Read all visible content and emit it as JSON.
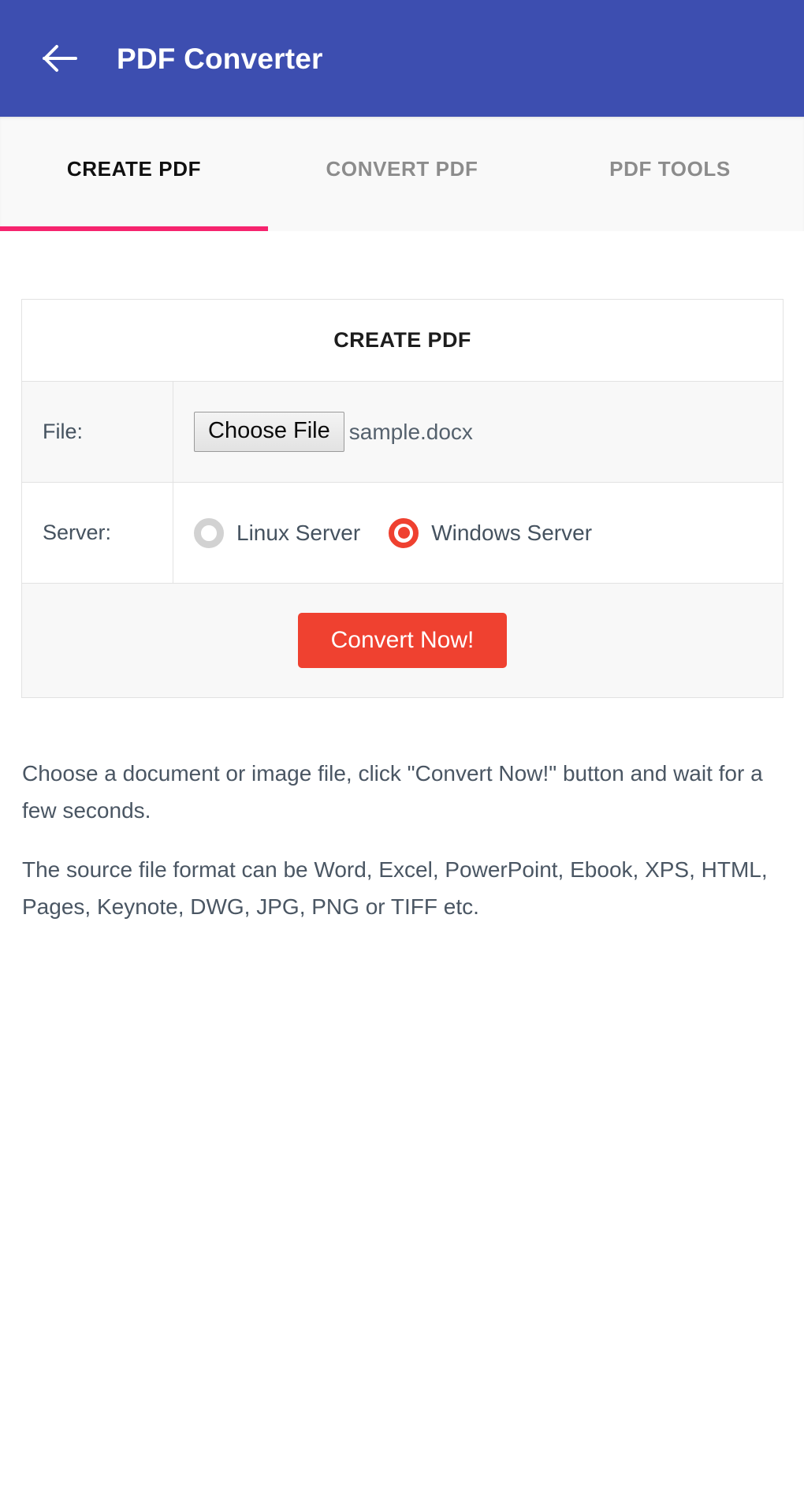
{
  "appbar": {
    "back_icon": "arrow-left-icon",
    "title": "PDF Converter",
    "background_color": "#3d4eb0"
  },
  "tabs": {
    "indicator_color": "#f6246e",
    "items": [
      {
        "label": "CREATE PDF",
        "active": true
      },
      {
        "label": "CONVERT PDF",
        "active": false
      },
      {
        "label": "PDF TOOLS",
        "active": false
      }
    ]
  },
  "card": {
    "header": "CREATE PDF",
    "file_row": {
      "label": "File:",
      "choose_button": "Choose File",
      "file_name": "sample.docx"
    },
    "server_row": {
      "label": "Server:",
      "options": [
        {
          "label": "Linux Server",
          "selected": false
        },
        {
          "label": "Windows Server",
          "selected": true
        }
      ],
      "selected_color": "#ef4130"
    },
    "submit": {
      "label": "Convert Now!",
      "color": "#ef4130"
    }
  },
  "help": {
    "paragraph1": "Choose a document or image file, click \"Convert Now!\" button and wait for a few seconds.",
    "paragraph2": "The source file format can be Word, Excel, PowerPoint, Ebook, XPS, HTML, Pages, Keynote, DWG, JPG, PNG or TIFF etc."
  }
}
